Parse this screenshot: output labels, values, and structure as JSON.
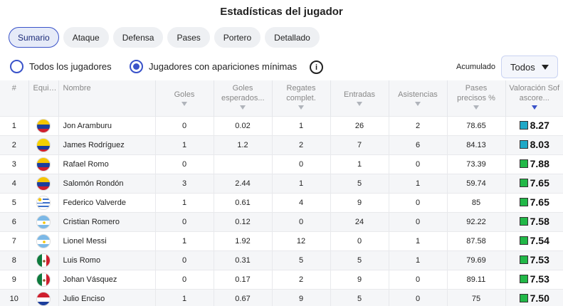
{
  "title": "Estadísticas del jugador",
  "tabs": [
    "Sumario",
    "Ataque",
    "Defensa",
    "Pases",
    "Portero",
    "Detallado"
  ],
  "active_tab": 0,
  "filters": {
    "all_players": "Todos los jugadores",
    "min_apps": "Jugadores con apariciones mínimas",
    "selected": "min_apps",
    "info_icon": "i",
    "acum_label": "Acumulado",
    "select_value": "Todos"
  },
  "columns": {
    "rank": "#",
    "team": "Equi…",
    "name": "Nombre",
    "goals": "Goles",
    "xg": "Goles esperados...",
    "dribbles": "Regates complet.",
    "tackles": "Entradas",
    "assists": "Asistencias",
    "passes": "Pases precisos %",
    "rating": "Valoración Sofascore..."
  },
  "colors": {
    "accent": "#3a53c9",
    "rating_blue": "#1fa8c7",
    "rating_green": "#22b848"
  },
  "rows": [
    {
      "rank": "1",
      "flag": "venezuela",
      "name": "Jon Aramburu",
      "goals": "0",
      "xg": "0.02",
      "dribbles": "1",
      "tackles": "26",
      "assists": "2",
      "passes": "78.65",
      "rating": "8.27",
      "rating_color": "#1fa8c7"
    },
    {
      "rank": "2",
      "flag": "colombia",
      "name": "James Rodríguez",
      "goals": "1",
      "xg": "1.2",
      "dribbles": "2",
      "tackles": "7",
      "assists": "6",
      "passes": "84.13",
      "rating": "8.03",
      "rating_color": "#1fa8c7"
    },
    {
      "rank": "3",
      "flag": "venezuela",
      "name": "Rafael Romo",
      "goals": "0",
      "xg": "",
      "dribbles": "0",
      "tackles": "1",
      "assists": "0",
      "passes": "73.39",
      "rating": "7.88",
      "rating_color": "#22b848"
    },
    {
      "rank": "4",
      "flag": "venezuela",
      "name": "Salomón Rondón",
      "goals": "3",
      "xg": "2.44",
      "dribbles": "1",
      "tackles": "5",
      "assists": "1",
      "passes": "59.74",
      "rating": "7.65",
      "rating_color": "#22b848"
    },
    {
      "rank": "5",
      "flag": "uruguay",
      "name": "Federico Valverde",
      "goals": "1",
      "xg": "0.61",
      "dribbles": "4",
      "tackles": "9",
      "assists": "0",
      "passes": "85",
      "rating": "7.65",
      "rating_color": "#22b848"
    },
    {
      "rank": "6",
      "flag": "argentina",
      "name": "Cristian Romero",
      "goals": "0",
      "xg": "0.12",
      "dribbles": "0",
      "tackles": "24",
      "assists": "0",
      "passes": "92.22",
      "rating": "7.58",
      "rating_color": "#22b848"
    },
    {
      "rank": "7",
      "flag": "argentina",
      "name": "Lionel Messi",
      "goals": "1",
      "xg": "1.92",
      "dribbles": "12",
      "tackles": "0",
      "assists": "1",
      "passes": "87.58",
      "rating": "7.54",
      "rating_color": "#22b848"
    },
    {
      "rank": "8",
      "flag": "mexico",
      "name": "Luis Romo",
      "goals": "0",
      "xg": "0.31",
      "dribbles": "5",
      "tackles": "5",
      "assists": "1",
      "passes": "79.69",
      "rating": "7.53",
      "rating_color": "#22b848"
    },
    {
      "rank": "9",
      "flag": "mexico",
      "name": "Johan Vásquez",
      "goals": "0",
      "xg": "0.17",
      "dribbles": "2",
      "tackles": "9",
      "assists": "0",
      "passes": "89.11",
      "rating": "7.53",
      "rating_color": "#22b848"
    },
    {
      "rank": "10",
      "flag": "paraguay",
      "name": "Julio Enciso",
      "goals": "1",
      "xg": "0.67",
      "dribbles": "9",
      "tackles": "5",
      "assists": "0",
      "passes": "75",
      "rating": "7.50",
      "rating_color": "#22b848"
    }
  ]
}
